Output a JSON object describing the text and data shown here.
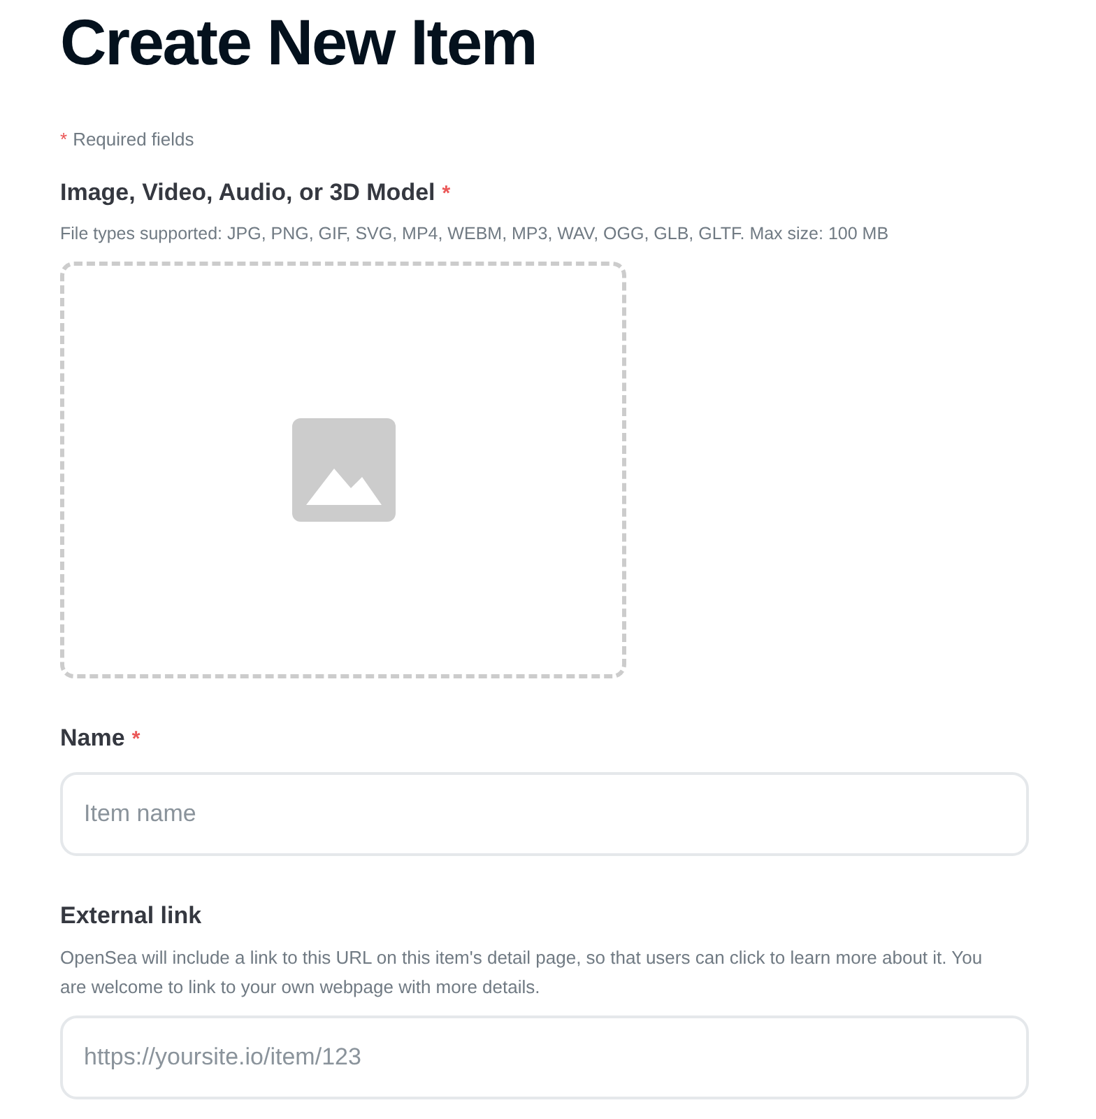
{
  "title": "Create New Item",
  "required_note": {
    "mark": "*",
    "text": "Required fields"
  },
  "media": {
    "label": "Image, Video, Audio, or 3D Model",
    "required_mark": "*",
    "hint": "File types supported: JPG, PNG, GIF, SVG, MP4, WEBM, MP3, WAV, OGG, GLB, GLTF. Max size: 100 MB"
  },
  "name": {
    "label": "Name",
    "required_mark": "*",
    "placeholder": "Item name"
  },
  "external_link": {
    "label": "External link",
    "hint": "OpenSea will include a link to this URL on this item's detail page, so that users can click to learn more about it. You are welcome to link to your own webpage with more details.",
    "placeholder": "https://yoursite.io/item/123"
  }
}
